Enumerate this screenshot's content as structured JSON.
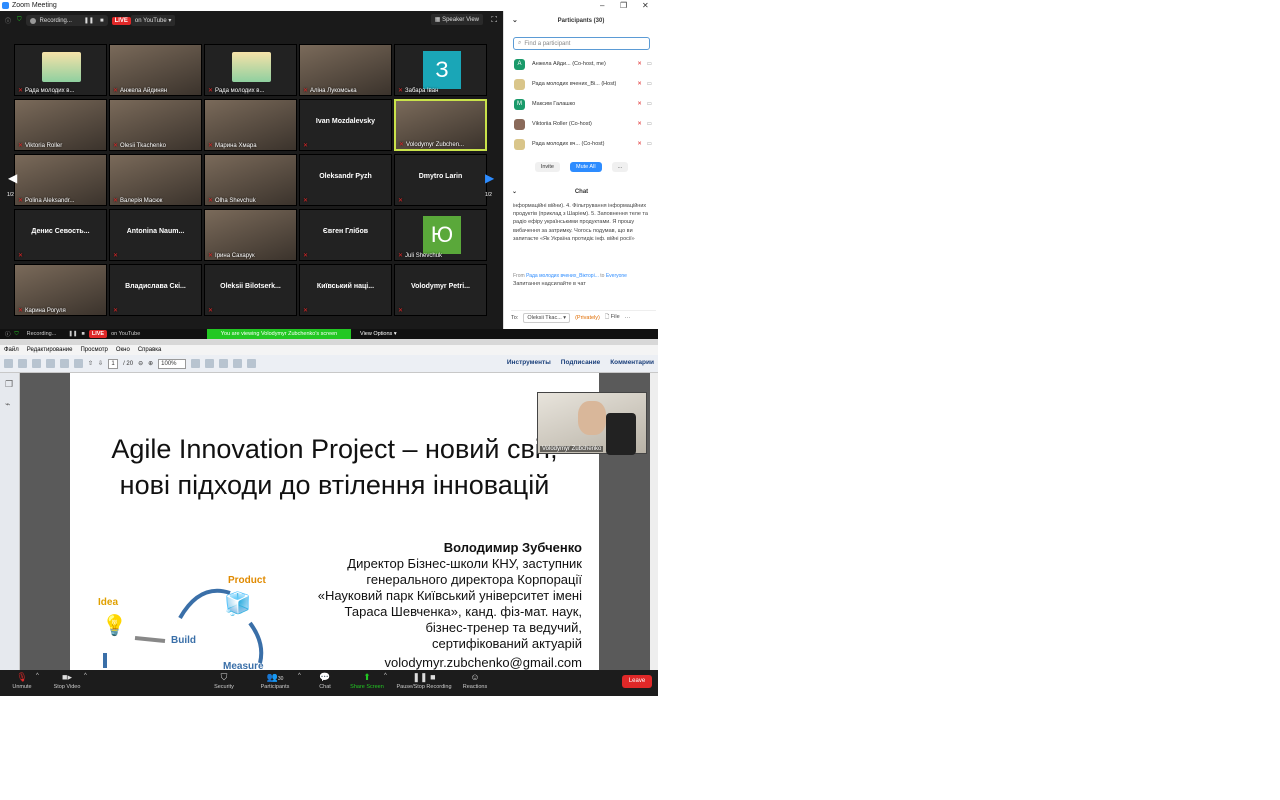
{
  "window": {
    "title": "Zoom Meeting"
  },
  "gallery_top": {
    "recording": "Recording...",
    "live": "LIVE",
    "stream": "on YouTube",
    "speaker_view": "Speaker View"
  },
  "tiles": [
    {
      "name": "Рада молодих в...",
      "kind": "logo"
    },
    {
      "name": "Анжела Айдинян",
      "kind": "vid"
    },
    {
      "name": "Рада молодих в...",
      "kind": "logo"
    },
    {
      "name": "Аліна Лукомська",
      "kind": "vid"
    },
    {
      "name": "Забара Іван",
      "kind": "avatar",
      "letter": "З",
      "color": "#1aa6b7"
    },
    {
      "name": "Viktoria Roller",
      "kind": "vid"
    },
    {
      "name": "Olesii Tkachenko",
      "kind": "vid"
    },
    {
      "name": "Марина Хмара",
      "kind": "vid"
    },
    {
      "name": "Ivan Mozdalevsky",
      "kind": "text"
    },
    {
      "name": "Volodymyr Zubchen...",
      "kind": "vid",
      "active": true
    },
    {
      "name": "Polina Aleksandr...",
      "kind": "vid"
    },
    {
      "name": "Валерія Масюк",
      "kind": "vid"
    },
    {
      "name": "Olha Shevchuk",
      "kind": "vid"
    },
    {
      "name": "Oleksandr Pyzh",
      "kind": "text"
    },
    {
      "name": "Dmytro Larin",
      "kind": "text"
    },
    {
      "name": "Денис Севость...",
      "kind": "text"
    },
    {
      "name": "Antonina Naum...",
      "kind": "text"
    },
    {
      "name": "Ірина Сахарук",
      "kind": "vid"
    },
    {
      "name": "Євген Глібов",
      "kind": "text"
    },
    {
      "name": "Juli Shevchuk",
      "kind": "avatar",
      "letter": "Ю",
      "color": "#5aa83a"
    },
    {
      "name": "Карина Рогуля",
      "kind": "vid"
    },
    {
      "name": "Владислава Скі...",
      "kind": "text"
    },
    {
      "name": "Oleksii Bilotserk...",
      "kind": "text"
    },
    {
      "name": "Київський наці...",
      "kind": "text"
    },
    {
      "name": "Volodymyr Petri...",
      "kind": "text"
    }
  ],
  "page_indicator": "1/2",
  "participants": {
    "title": "Participants (30)",
    "search_placeholder": "Find a participant",
    "rows": [
      {
        "name": "Анжела Айди... (Co-host, me)",
        "avatar": "А",
        "color": "#1a9a6a"
      },
      {
        "name": "Рада молодих вчених_Ві... (Host)",
        "avatar": "",
        "color": "#d9c58a"
      },
      {
        "name": "Максим Галашко",
        "avatar": "М",
        "color": "#1a9a6a"
      },
      {
        "name": "Viktoriia Roller (Co-host)",
        "avatar": "",
        "color": "#8a6a5a"
      },
      {
        "name": "Рада молодих вч... (Co-host)",
        "avatar": "",
        "color": "#d9c58a"
      }
    ],
    "invite": "Invite",
    "mute_all": "Mute All",
    "more": "..."
  },
  "chat": {
    "title": "Chat",
    "message": "інформаційні війни). 4. Фільтрування інформаційних продуктів (приклад з Шаріем). 5. Заповнення теле та радіо ефіру українськими продуктами. Я прошу вибачення за затримку. Чогось подумав, що ви запитаєте «Як Україна протидіє інф. війні росії»",
    "from_label": "From",
    "from_name": "Рада молодих вчених_Вікторі...",
    "to_label": "to",
    "to_name": "Everyone",
    "message2": "Запитання надсилайте в чат",
    "to": "To:",
    "to_select": "Oleksii Tkac...",
    "privately": "(Privately)",
    "file": "File",
    "dots": "···"
  },
  "share_bar": {
    "recording": "Recording...",
    "live": "LIVE",
    "stream": "on YouTube",
    "banner": "You are viewing Volodymyr Zubchenko's screen",
    "view_options": "View Options"
  },
  "reader": {
    "menu": [
      "Файл",
      "Редактирование",
      "Просмотр",
      "Окно",
      "Справка"
    ],
    "page": "1",
    "pages": "/ 20",
    "zoom": "100%",
    "links": [
      "Инструменты",
      "Подписание",
      "Комментарии"
    ]
  },
  "slide": {
    "title1": "Agile Innovation Project – новий світ,",
    "title2": "нові підходи до втілення інновацій",
    "author": "Володимир Зубченко",
    "lines": [
      "Директор Бізнес-школи КНУ, заступник",
      "генерального директора Корпорації",
      "«Науковий парк Київський університет імені",
      "Тараса Шевченка», канд. фіз-мат. наук,",
      "бізнес-тренер та ведучий,",
      "сертифікований актуарій"
    ],
    "email": "volodymyr.zubchenko@gmail.com",
    "diagram": {
      "idea": "Idea",
      "build": "Build",
      "product": "Product",
      "measure": "Measure"
    }
  },
  "pip": {
    "name": "Volodymyr Zubchenko"
  },
  "toolbar": {
    "unmute": "Unmute",
    "stop_video": "Stop Video",
    "security": "Security",
    "participants": "Participants",
    "participants_count": "30",
    "chat": "Chat",
    "share": "Share Screen",
    "pause_rec": "Pause/Stop Recording",
    "reactions": "Reactions",
    "leave": "Leave"
  }
}
